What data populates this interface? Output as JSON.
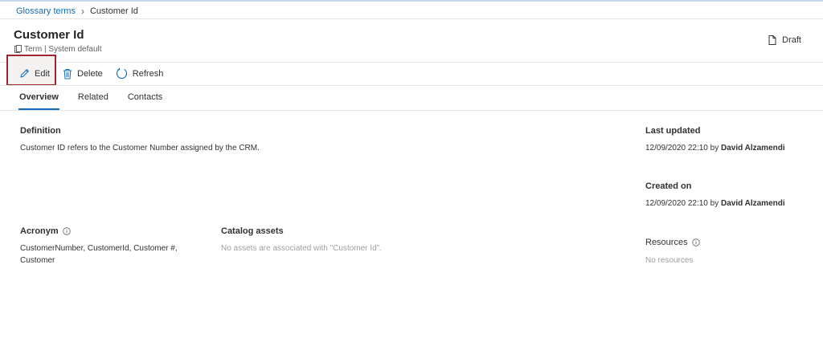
{
  "breadcrumb": {
    "parent": "Glossary terms",
    "separator": "›",
    "current": "Customer Id"
  },
  "header": {
    "title": "Customer Id",
    "subtitle": "Term | System default",
    "status": "Draft"
  },
  "toolbar": {
    "edit": "Edit",
    "delete": "Delete",
    "refresh": "Refresh"
  },
  "tabs": [
    "Overview",
    "Related",
    "Contacts"
  ],
  "definition": {
    "label": "Definition",
    "text": "Customer ID refers to the Customer Number assigned by the CRM."
  },
  "acronym": {
    "label": "Acronym",
    "line1": "CustomerNumber, CustomerId, Customer #,",
    "line2": "Customer"
  },
  "catalog_assets": {
    "label": "Catalog assets",
    "empty": "No assets are associated with \"Customer Id\"."
  },
  "last_updated": {
    "label": "Last updated",
    "date": "12/09/2020 22:10 by ",
    "user": "David Alzamendi"
  },
  "created_on": {
    "label": "Created on",
    "date": "12/09/2020 22:10 by ",
    "user": "David Alzamendi"
  },
  "resources": {
    "label": "Resources",
    "empty": "No resources"
  },
  "colors": {
    "accent": "#0f6cbd",
    "highlight_border": "#a4262c"
  }
}
